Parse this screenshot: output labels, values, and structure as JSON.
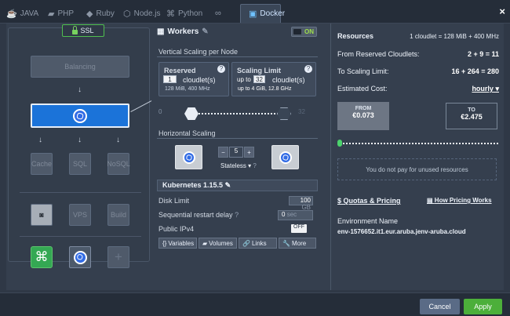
{
  "tabs": [
    "JAVA",
    "PHP",
    "Ruby",
    "Node.js",
    "Python",
    "",
    "Docker"
  ],
  "ssl": "SSL",
  "balancing": "Balancing",
  "nodes": [
    "Cache",
    "SQL",
    "NoSQL",
    "VPS",
    "Build"
  ],
  "workers": "Workers",
  "on": "ON",
  "vertical_scaling": "Vertical Scaling per Node",
  "reserved": {
    "title": "Reserved",
    "value": "1",
    "unit": "cloudlet(s)",
    "sub": "128 MiB, 400 MHz"
  },
  "scaling_limit": {
    "title": "Scaling Limit",
    "prefix": "up to",
    "value": "32",
    "unit": "cloudlet(s)",
    "sub": "up to 4 GiB, 12.8 GHz"
  },
  "slider": {
    "min": "0",
    "max": "32"
  },
  "horizontal_scaling": "Horizontal Scaling",
  "nodes_count": "5",
  "stateless": "Stateless",
  "kubernetes": "Kubernetes 1.15.5",
  "disk_limit": {
    "label": "Disk Limit",
    "value": "100",
    "unit": "GB"
  },
  "restart_delay": {
    "label": "Sequential restart delay",
    "value": "0",
    "unit": "sec"
  },
  "public_ipv4": {
    "label": "Public IPv4",
    "value": "OFF"
  },
  "actions": [
    "Variables",
    "Volumes",
    "Links",
    "More"
  ],
  "resources": {
    "title": "Resources",
    "cloudlet": "1 cloudlet = 128 MiB + 400 MHz",
    "reserved_label": "From Reserved Cloudlets:",
    "reserved_calc": "2 + 9 = 11",
    "scaling_label": "To Scaling Limit:",
    "scaling_calc": "16 + 264 = 280",
    "estimated_cost": "Estimated Cost:",
    "period": "hourly"
  },
  "pricing": {
    "from_label": "FROM",
    "from_value": "€0.073",
    "to_label": "TO",
    "to_value": "€2.475",
    "note": "You do not pay for unused resources"
  },
  "links": {
    "quotas": "Quotas & Pricing",
    "pricing": "How Pricing Works"
  },
  "environment": {
    "label": "Environment Name",
    "value": "env-1576652.it1.eur.aruba.jenv-aruba.cloud"
  },
  "footer": {
    "cancel": "Cancel",
    "apply": "Apply"
  }
}
